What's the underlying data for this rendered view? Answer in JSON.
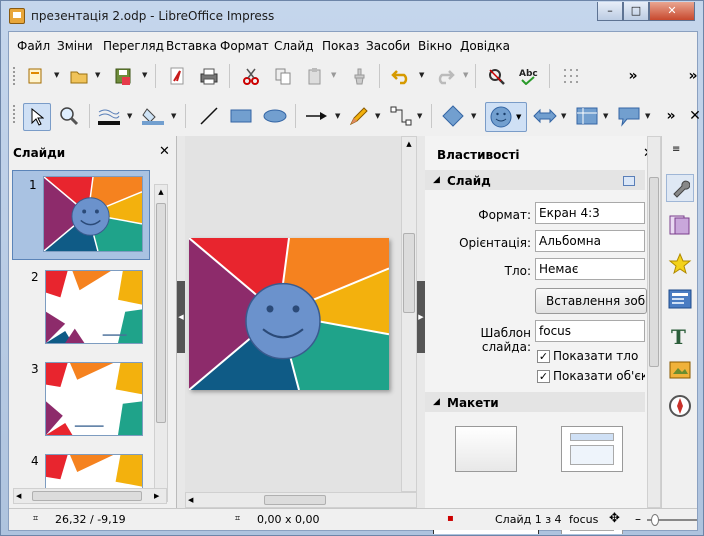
{
  "window": {
    "title": "презентація 2.odp - LibreOffice Impress",
    "min": "–",
    "max": "□",
    "close": "✕"
  },
  "menu": [
    "Файл",
    "Зміни",
    "Перегляд",
    "Вставка",
    "Формат",
    "Слайд",
    "Показ",
    "Засоби",
    "Вікно",
    "Довідка"
  ],
  "slides_panel": {
    "title": "Слайди",
    "close": "✕",
    "numbers": [
      "1",
      "2",
      "3",
      "4"
    ]
  },
  "properties": {
    "title": "Властивості",
    "close": "✕",
    "slide_section": "Слайд",
    "format_label": "Формат:",
    "format_value": "Екран 4:3",
    "orientation_label": "Орієнтація:",
    "orientation_value": "Альбомна",
    "background_label": "Тло:",
    "background_value": "Немає",
    "insert_image": "Вставлення зобра",
    "master_label": "Шаблон слайда:",
    "master_value": "focus",
    "show_background": "Показати тло",
    "show_objects": "Показати об'єкти",
    "layouts_section": "Макети"
  },
  "status": {
    "position": "26,32 / -9,19",
    "size": "0,00 x 0,00",
    "slide": "Слайд 1 з 4",
    "master": "focus"
  },
  "colors": {
    "red": "#e8252e",
    "orange": "#f5821f",
    "yellow": "#f3b10d",
    "green": "#1fa38a",
    "blue": "#0f5b86",
    "purple": "#8d2b6b",
    "smiley": "#6b92cc"
  }
}
